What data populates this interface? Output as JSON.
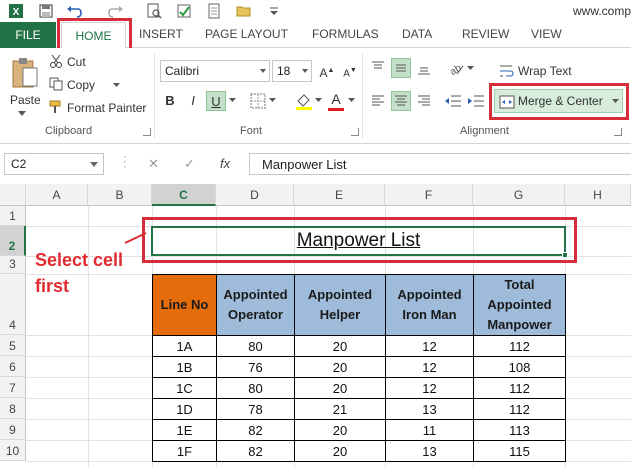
{
  "qat": {
    "url_text": "www.comp"
  },
  "tabs": [
    {
      "label": "FILE"
    },
    {
      "label": "HOME"
    },
    {
      "label": "INSERT"
    },
    {
      "label": "PAGE LAYOUT"
    },
    {
      "label": "FORMULAS"
    },
    {
      "label": "DATA"
    },
    {
      "label": "REVIEW"
    },
    {
      "label": "VIEW"
    }
  ],
  "ribbon": {
    "clipboard": {
      "paste_label": "Paste",
      "cut_label": "Cut",
      "copy_label": "Copy",
      "format_painter_label": "Format Painter",
      "group_label": "Clipboard"
    },
    "font": {
      "font_name": "Calibri",
      "font_size": "18",
      "group_label": "Font",
      "bold": "B",
      "italic": "I",
      "underline": "U",
      "font_color_letter": "A"
    },
    "alignment": {
      "wrap_text_label": "Wrap Text",
      "merge_center_label": "Merge & Center",
      "group_label": "Alignment"
    }
  },
  "formula_bar": {
    "name_box": "C2",
    "fx_label": "fx",
    "content": "Manpower List"
  },
  "columns": [
    "A",
    "B",
    "C",
    "D",
    "E",
    "F",
    "G",
    "H"
  ],
  "rows": [
    "1",
    "2",
    "3",
    "4",
    "5",
    "6",
    "7",
    "8",
    "9",
    "10"
  ],
  "sheet": {
    "title": "Manpower List",
    "headers": [
      "Line No",
      "Appointed Operator",
      "Appointed Helper",
      "Appointed Iron Man",
      "Total Appointed Manpower"
    ],
    "data": [
      [
        "1A",
        "80",
        "20",
        "12",
        "112"
      ],
      [
        "1B",
        "76",
        "20",
        "12",
        "108"
      ],
      [
        "1C",
        "80",
        "20",
        "12",
        "112"
      ],
      [
        "1D",
        "78",
        "21",
        "13",
        "112"
      ],
      [
        "1E",
        "82",
        "20",
        "11",
        "113"
      ],
      [
        "1F",
        "82",
        "20",
        "13",
        "115"
      ]
    ]
  },
  "annotation": {
    "line1": "Select cell",
    "line2": "first"
  },
  "colors": {
    "accent": "#217346",
    "highlight_box": "#d42e3a",
    "header_blue": "#9ebbd9",
    "header_orange": "#e46c0a",
    "annotation_red": "#e02b30"
  }
}
